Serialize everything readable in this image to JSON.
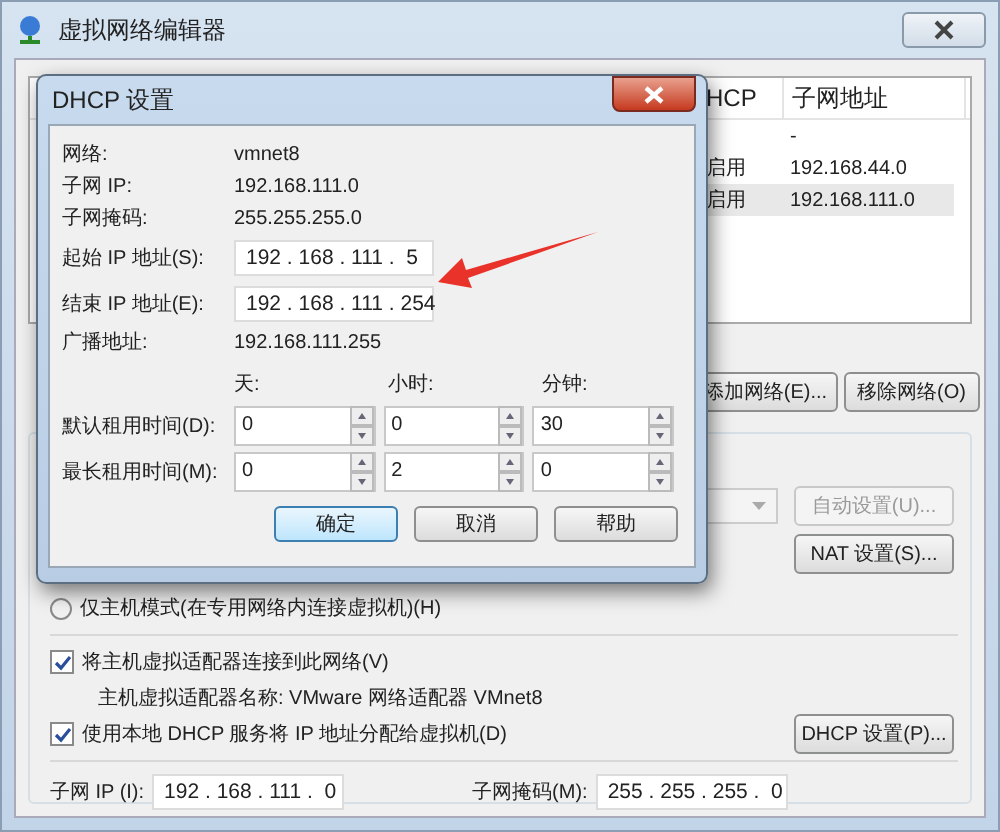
{
  "window": {
    "title": "虚拟网络编辑器"
  },
  "table": {
    "columns": [
      "HCP",
      "子网地址"
    ],
    "rows": [
      {
        "subnet": "-",
        "selected": false
      },
      {
        "dhcp": "启用",
        "subnet": "192.168.44.0",
        "selected": false
      },
      {
        "dhcp": "启用",
        "subnet": "192.168.111.0",
        "selected": true
      }
    ]
  },
  "table_buttons": [
    "添加网络(E)...",
    "移除网络(O)"
  ],
  "settings": {
    "auto_button": {
      "label": "自动设置(U)...",
      "disabled": true
    },
    "nat_button": "NAT 设置(S)...",
    "host_only": {
      "label": "仅主机模式(在专用网络内连接虚拟机)(H)",
      "selected": false
    },
    "connect_adapter": {
      "label": "将主机虚拟适配器连接到此网络(V)",
      "checked": true
    },
    "adapter_name": "主机虚拟适配器名称: VMware 网络适配器 VMnet8",
    "use_dhcp": {
      "label": "使用本地 DHCP 服务将 IP 地址分配给虚拟机(D)",
      "checked": true
    },
    "dhcp_button": "DHCP 设置(P)...",
    "subnet_ip": {
      "label": "子网 IP (I):",
      "value": "192 . 168 . 111 .  0"
    },
    "subnet_mask": {
      "label": "子网掩码(M):",
      "value": "255 . 255 . 255 .  0"
    }
  },
  "dialog": {
    "title": "DHCP 设置",
    "info": [
      {
        "label": "网络:",
        "value": "vmnet8"
      },
      {
        "label": "子网 IP:",
        "value": "192.168.111.0"
      },
      {
        "label": "子网掩码:",
        "value": "255.255.255.0"
      }
    ],
    "start": {
      "label": "起始 IP 地址(S):",
      "value": "192 . 168 . 111 .  5"
    },
    "end": {
      "label": "结束 IP 地址(E):",
      "value": "192 . 168 . 111 . 254"
    },
    "broadcast": {
      "label": "广播地址:",
      "value": "192.168.111.255"
    },
    "lease_columns": [
      "天:",
      "小时:",
      "分钟:"
    ],
    "leases": [
      {
        "label": "默认租用时间(D):",
        "values": [
          "0",
          "0",
          "30"
        ]
      },
      {
        "label": "最长租用时间(M):",
        "values": [
          "0",
          "2",
          "0"
        ]
      }
    ],
    "buttons": [
      {
        "label": "确定",
        "default": true
      },
      {
        "label": "取消",
        "default": false
      },
      {
        "label": "帮助",
        "default": false
      }
    ]
  }
}
